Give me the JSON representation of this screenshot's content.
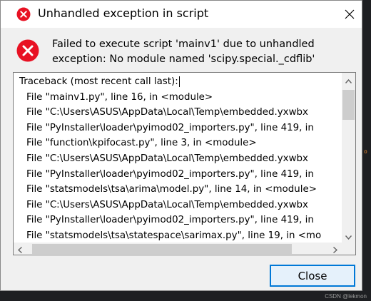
{
  "window": {
    "title": "Unhandled exception in script",
    "close_glyph": "✕"
  },
  "message": {
    "line1": "Failed to execute script 'mainv1' due to unhandled",
    "line2": "exception: No module named 'scipy.special._cdflib'"
  },
  "traceback": {
    "lines": [
      "Traceback (most recent call last):",
      "File \"mainv1.py\", line 16, in <module>",
      "File \"C:\\Users\\ASUS\\AppData\\Local\\Temp\\embedded.yxwbx",
      "File \"PyInstaller\\loader\\pyimod02_importers.py\", line 419, in",
      "File \"function\\kpifocast.py\", line 3, in <module>",
      "File \"C:\\Users\\ASUS\\AppData\\Local\\Temp\\embedded.yxwbx",
      "File \"PyInstaller\\loader\\pyimod02_importers.py\", line 419, in",
      "File \"statsmodels\\tsa\\arima\\model.py\", line 14, in <module>",
      "File \"C:\\Users\\ASUS\\AppData\\Local\\Temp\\embedded.yxwbx",
      "File \"PyInstaller\\loader\\pyimod02_importers.py\", line 419, in",
      "File \"statsmodels\\tsa\\statespace\\sarimax.py\", line 19, in <mo"
    ]
  },
  "buttons": {
    "close_label": "Close"
  },
  "background": {
    "watermark": "CSDN @lekmon"
  },
  "colors": {
    "error_red": "#e81123",
    "accent_blue": "#0078d7"
  },
  "icons": {
    "title": "error-icon",
    "message": "error-icon",
    "window_close": "close-icon"
  }
}
